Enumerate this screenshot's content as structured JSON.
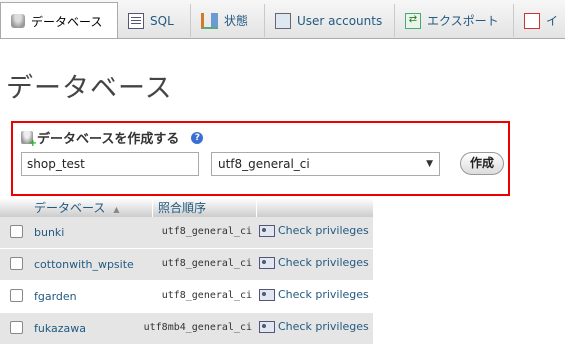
{
  "tabs": [
    {
      "label": "データベース",
      "icon": "database-icon",
      "active": true
    },
    {
      "label": "SQL",
      "icon": "sql-icon",
      "active": false
    },
    {
      "label": "状態",
      "icon": "status-icon",
      "active": false
    },
    {
      "label": "User accounts",
      "icon": "user-accounts-icon",
      "active": false
    },
    {
      "label": "エクスポート",
      "icon": "export-icon",
      "active": false
    },
    {
      "label": "イ",
      "icon": "import-icon",
      "active": false
    }
  ],
  "page": {
    "title": "データベース"
  },
  "create_db": {
    "legend": "データベースを作成する",
    "name_value": "shop_test",
    "collation_selected": "utf8_general_ci",
    "create_label": "作成"
  },
  "table": {
    "headers": {
      "name": "データベース",
      "collation": "照合順序"
    },
    "rows": [
      {
        "name": "bunki",
        "collation": "utf8_general_ci",
        "action": "Check privileges"
      },
      {
        "name": "cottonwith_wpsite",
        "collation": "utf8_general_ci",
        "action": "Check privileges"
      },
      {
        "name": "fgarden",
        "collation": "utf8_general_ci",
        "action": "Check privileges"
      },
      {
        "name": "fukazawa",
        "collation": "utf8mb4_general_ci",
        "action": "Check privileges"
      }
    ]
  },
  "colors": {
    "highlight_border": "#e00000",
    "link": "#235a81"
  }
}
